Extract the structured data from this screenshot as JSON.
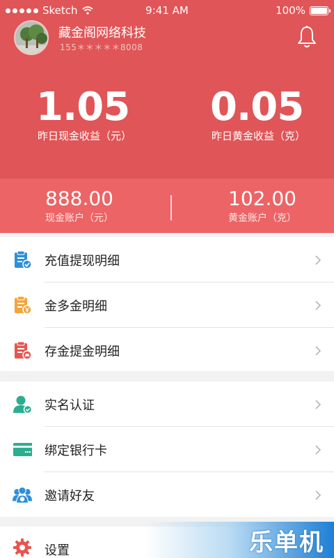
{
  "status_bar": {
    "carrier": "Sketch",
    "time": "9:41 AM",
    "battery": "100%"
  },
  "profile": {
    "company": "藏金阁网络科技",
    "phone": "155＊＊＊＊＊8008"
  },
  "earnings": {
    "cash_value": "1.05",
    "cash_label": "昨日现金收益（元）",
    "gold_value": "0.05",
    "gold_label": "昨日黄金收益（克）"
  },
  "accounts": {
    "cash_value": "888.00",
    "cash_label": "现金账户（元）",
    "gold_value": "102.00",
    "gold_label": "黄金账户（克）"
  },
  "menu_group_1": [
    {
      "label": "充值提现明细",
      "icon": "clipboard-check-icon",
      "color": "#2e8fd8"
    },
    {
      "label": "金多金明细",
      "icon": "clipboard-yen-icon",
      "color": "#f3a43b"
    },
    {
      "label": "存金提金明细",
      "icon": "clipboard-gold-icon",
      "color": "#e8554e"
    }
  ],
  "menu_group_2": [
    {
      "label": "实名认证",
      "icon": "user-verified-icon",
      "color": "#2bae8f"
    },
    {
      "label": "绑定银行卡",
      "icon": "bank-card-icon",
      "color": "#2bae8f"
    },
    {
      "label": "邀请好友",
      "icon": "invite-friends-icon",
      "color": "#2e8fd8"
    }
  ],
  "menu_group_3": [
    {
      "label": "设置",
      "icon": "gear-icon",
      "color": "#e8554e"
    }
  ],
  "watermark": "乐单机",
  "colors": {
    "header": "#e05557",
    "accounts_bar": "#ec6466"
  }
}
